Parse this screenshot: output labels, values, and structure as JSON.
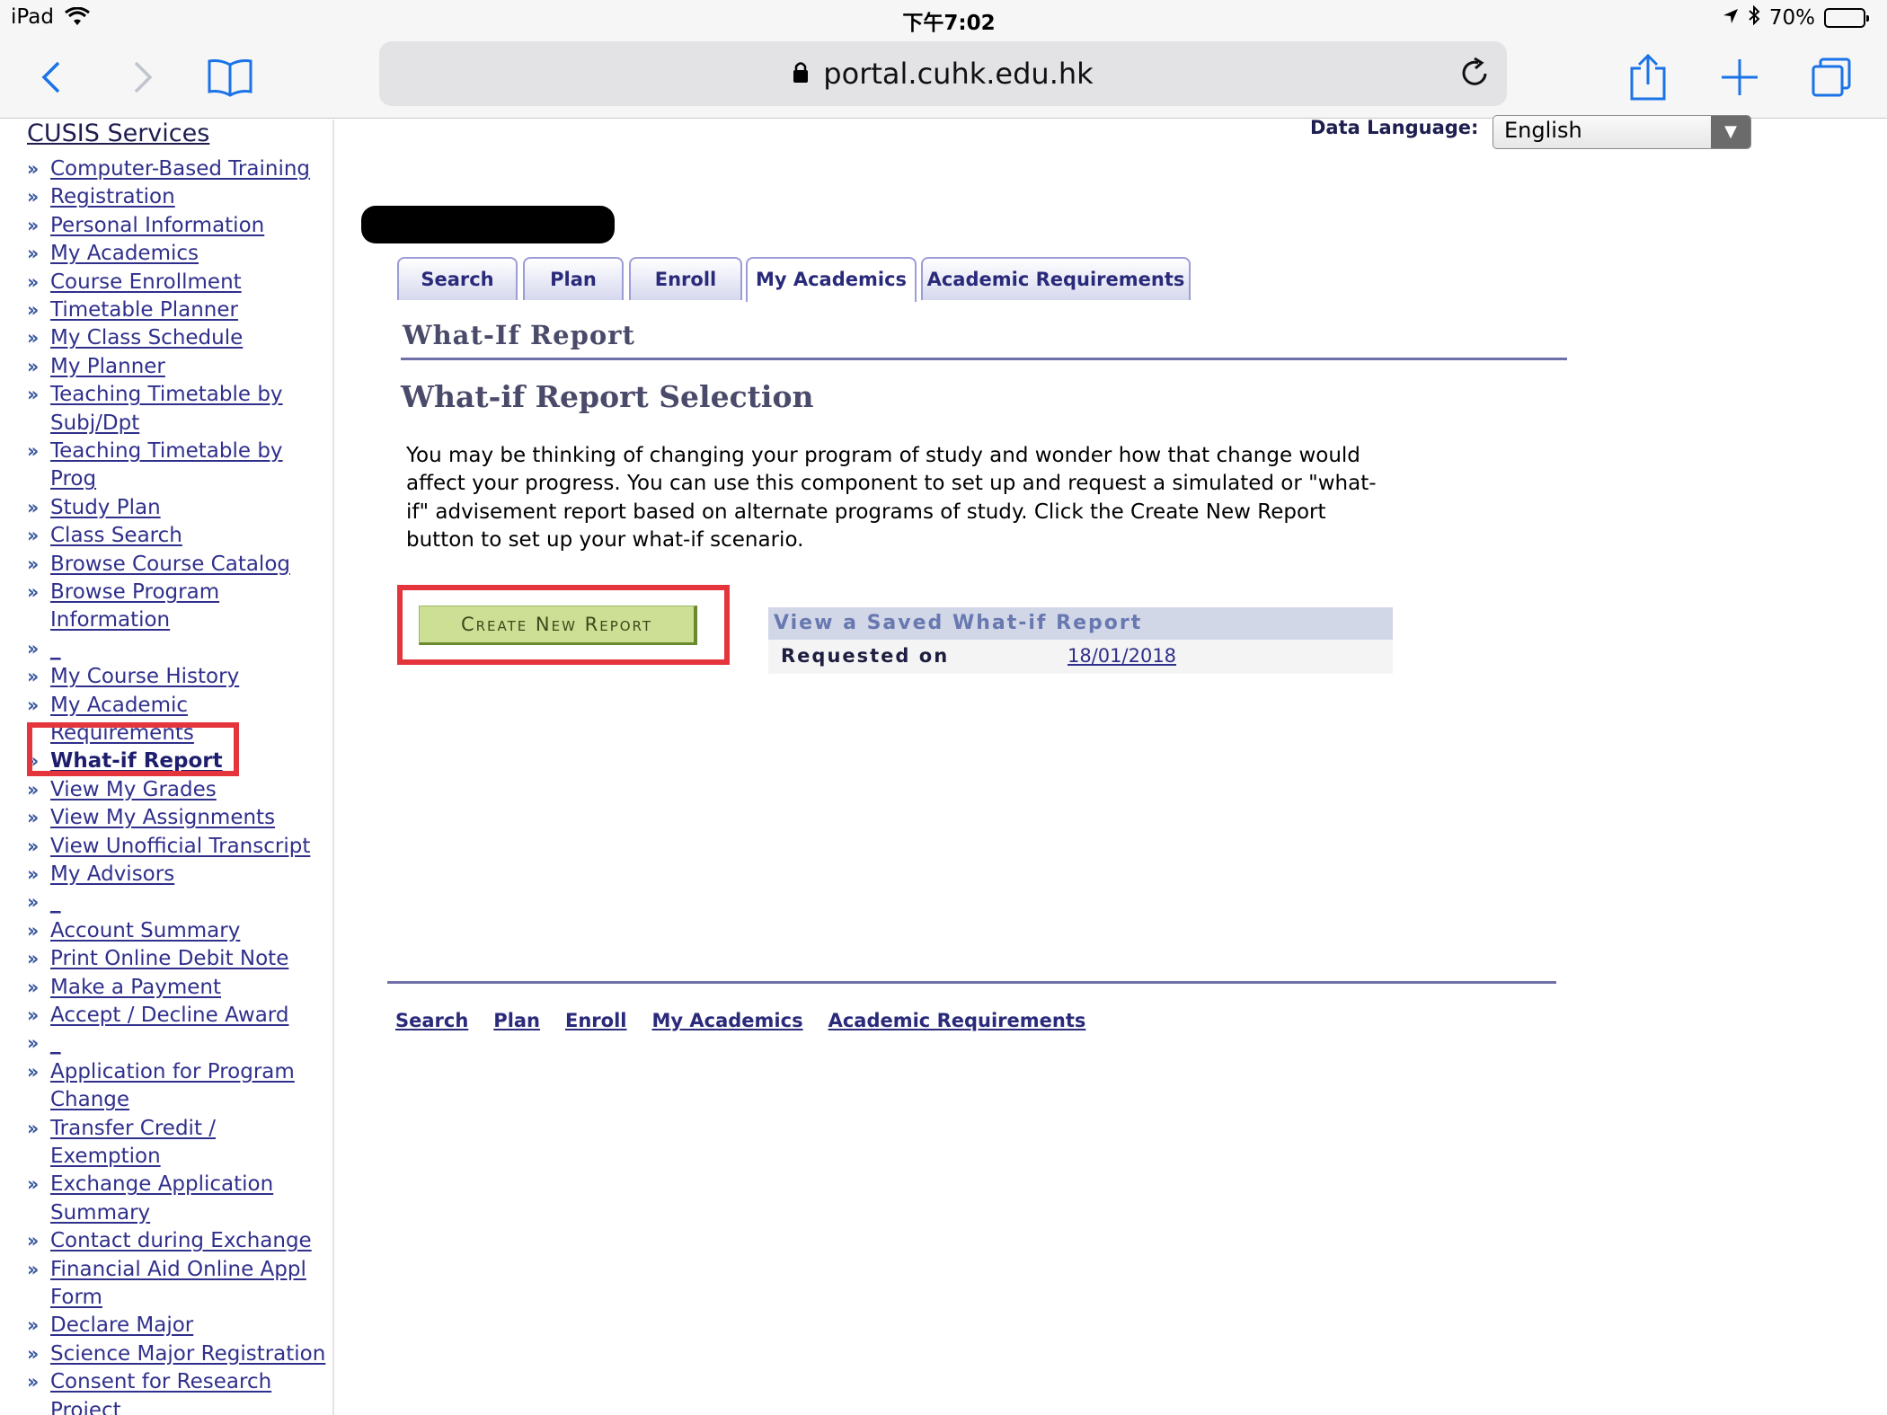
{
  "status_bar": {
    "device": "iPad",
    "time": "下午7:02",
    "battery": "70%",
    "battery_level": 0.7
  },
  "browser": {
    "url": "portal.cuhk.edu.hk",
    "icons": [
      "back-icon",
      "forward-icon",
      "bookmarks-icon",
      "lock-icon",
      "reload-icon",
      "share-icon",
      "new-tab-icon",
      "tabs-icon"
    ]
  },
  "sidebar": {
    "title": "CUSIS Services",
    "items": [
      {
        "lines": [
          "Computer-Based Training"
        ]
      },
      {
        "lines": [
          "Registration"
        ]
      },
      {
        "lines": [
          "Personal Information"
        ]
      },
      {
        "lines": [
          "My Academics"
        ]
      },
      {
        "lines": [
          "Course Enrollment"
        ]
      },
      {
        "lines": [
          "Timetable Planner"
        ]
      },
      {
        "lines": [
          "My Class Schedule"
        ]
      },
      {
        "lines": [
          "My Planner"
        ]
      },
      {
        "lines": [
          "Teaching Timetable by",
          "Subj/Dpt"
        ]
      },
      {
        "lines": [
          "Teaching Timetable by",
          "Prog"
        ]
      },
      {
        "lines": [
          "Study Plan"
        ]
      },
      {
        "lines": [
          "Class Search"
        ]
      },
      {
        "lines": [
          "Browse Course Catalog"
        ]
      },
      {
        "lines": [
          "Browse Program",
          "Information"
        ]
      },
      {
        "lines": [
          "_"
        ]
      },
      {
        "lines": [
          "My Course History"
        ]
      },
      {
        "lines": [
          "My Academic",
          "Requirements"
        ]
      },
      {
        "lines": [
          "What-if Report"
        ],
        "current": true
      },
      {
        "lines": [
          "View My Grades"
        ]
      },
      {
        "lines": [
          "View My Assignments"
        ]
      },
      {
        "lines": [
          "View Unofficial Transcript"
        ]
      },
      {
        "lines": [
          "My Advisors"
        ]
      },
      {
        "lines": [
          "_"
        ]
      },
      {
        "lines": [
          "Account Summary"
        ]
      },
      {
        "lines": [
          "Print Online Debit Note"
        ]
      },
      {
        "lines": [
          "Make a Payment"
        ]
      },
      {
        "lines": [
          "Accept / Decline Award"
        ]
      },
      {
        "lines": [
          "_"
        ]
      },
      {
        "lines": [
          "Application for Program",
          "Change"
        ]
      },
      {
        "lines": [
          "Transfer Credit /",
          "Exemption"
        ]
      },
      {
        "lines": [
          "Exchange Application",
          "Summary"
        ]
      },
      {
        "lines": [
          "Contact during Exchange"
        ]
      },
      {
        "lines": [
          "Financial Aid Online Appl",
          "Form"
        ]
      },
      {
        "lines": [
          "Declare Major"
        ]
      },
      {
        "lines": [
          "Science Major Registration"
        ]
      },
      {
        "lines": [
          "Consent for Research",
          "Project"
        ]
      }
    ]
  },
  "data_language": {
    "label": "Data Language:",
    "selected": "English"
  },
  "tabs": [
    "Search",
    "Plan",
    "Enroll",
    "My Academics",
    "Academic Requirements"
  ],
  "active_tab": "My Academics",
  "page_header": "What-If Report",
  "section_title": "What-if Report Selection",
  "intro_lines": [
    "You may be thinking of changing your program of study and wonder how that change would",
    "affect your progress. You can use this component to set up and request a simulated or \"what-",
    "if\" advisement report based on alternate programs of study. Click the Create New Report",
    "button to set up your what-if scenario."
  ],
  "create_button": "Create New Report",
  "saved_report": {
    "header": "View a Saved What-if Report",
    "label": "Requested on",
    "date": "18/01/2018"
  },
  "footer_links": [
    "Search",
    "Plan",
    "Enroll",
    "My Academics",
    "Academic Requirements"
  ],
  "colors": {
    "link": "#30308c",
    "highlight": "#e4353c",
    "button": "#ccdf94",
    "tab_border": "#9c9cd6"
  }
}
